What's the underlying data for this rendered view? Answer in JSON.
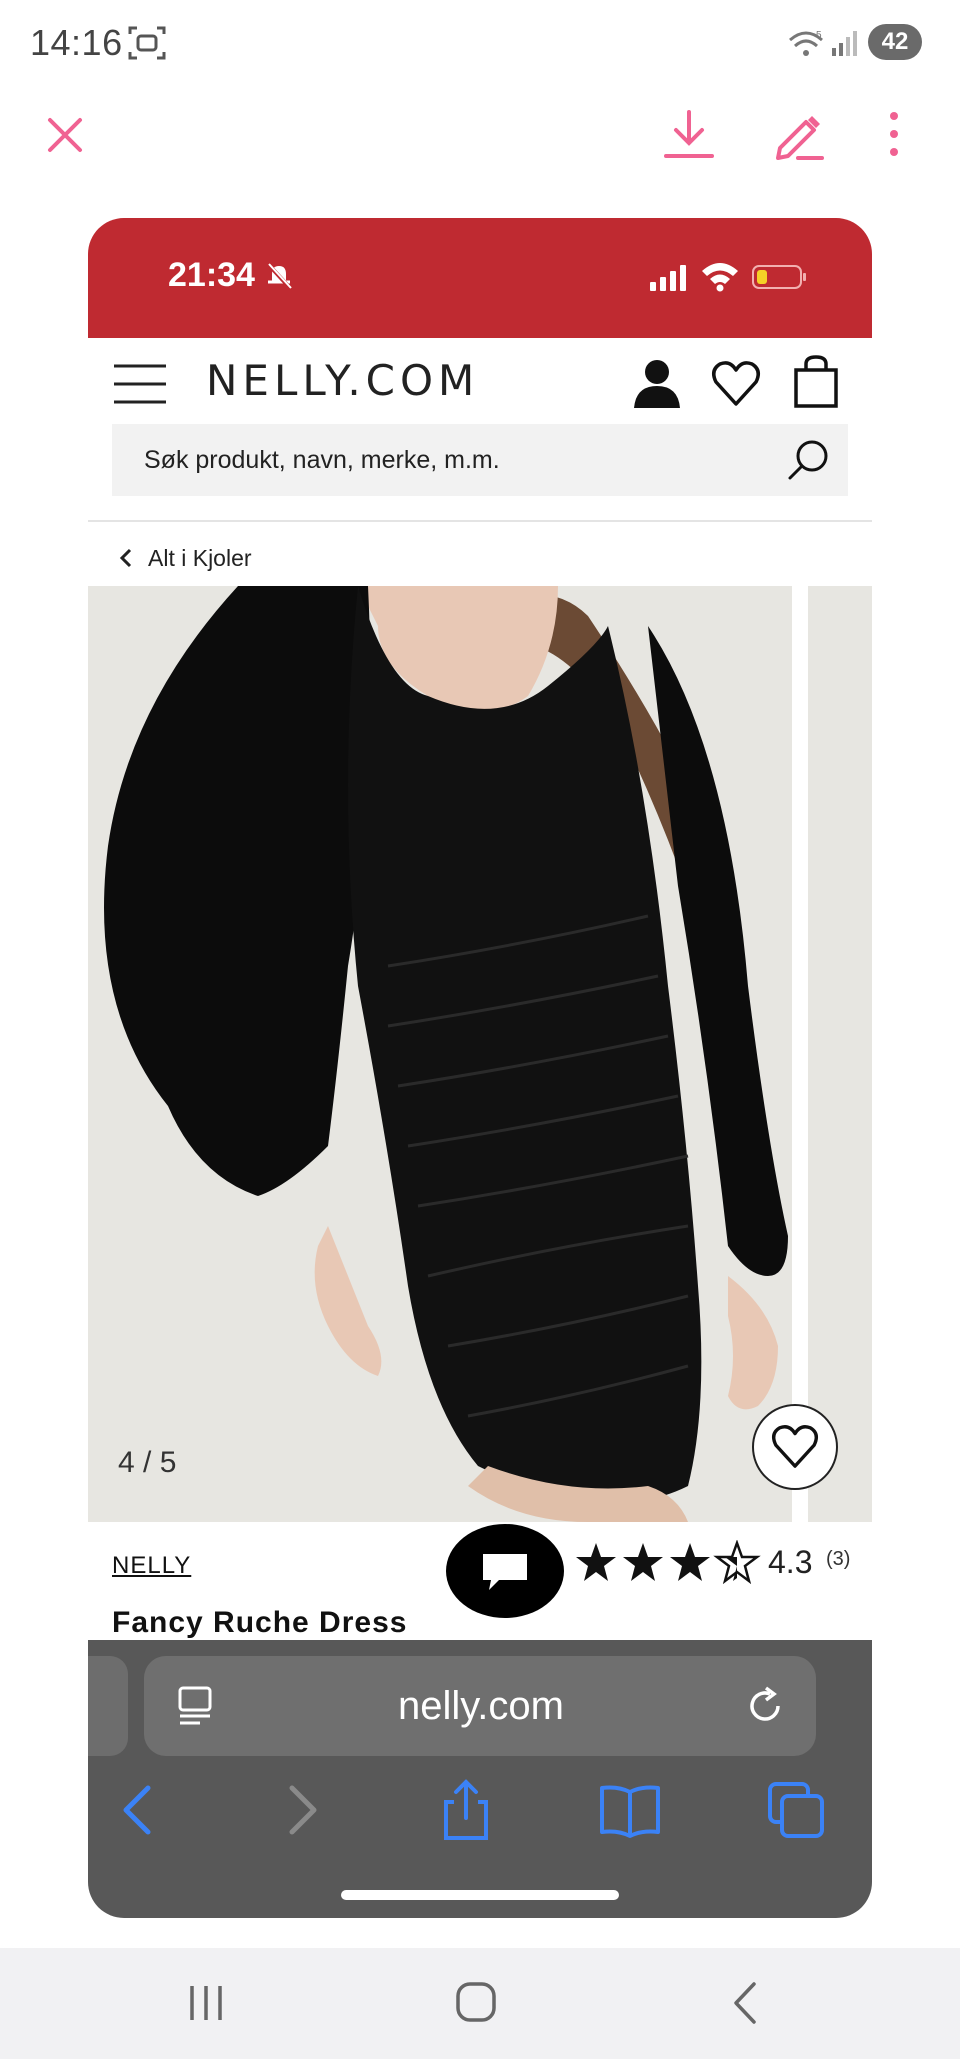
{
  "os_status": {
    "time": "14:16",
    "battery": "42",
    "wifi_superscript": "5"
  },
  "viewer": {
    "icons": [
      "close-icon",
      "download-icon",
      "edit-icon",
      "more-icon"
    ],
    "accent_color": "#f06292"
  },
  "phone": {
    "status": {
      "time": "21:34",
      "bar_color": "#bf2a31"
    },
    "header": {
      "logo": "NELLY.COM"
    },
    "search": {
      "placeholder": "Søk produkt, navn, merke, m.m."
    },
    "breadcrumb": {
      "label": "Alt i Kjoler"
    },
    "gallery": {
      "counter": "4 / 5"
    },
    "product": {
      "brand": "NELLY",
      "title": "Fancy Ruche Dress",
      "rating": "4.3",
      "rating_count": "(3)",
      "rating_value": 4.3,
      "rating_max": 5
    },
    "browser": {
      "url": "nelly.com"
    }
  }
}
